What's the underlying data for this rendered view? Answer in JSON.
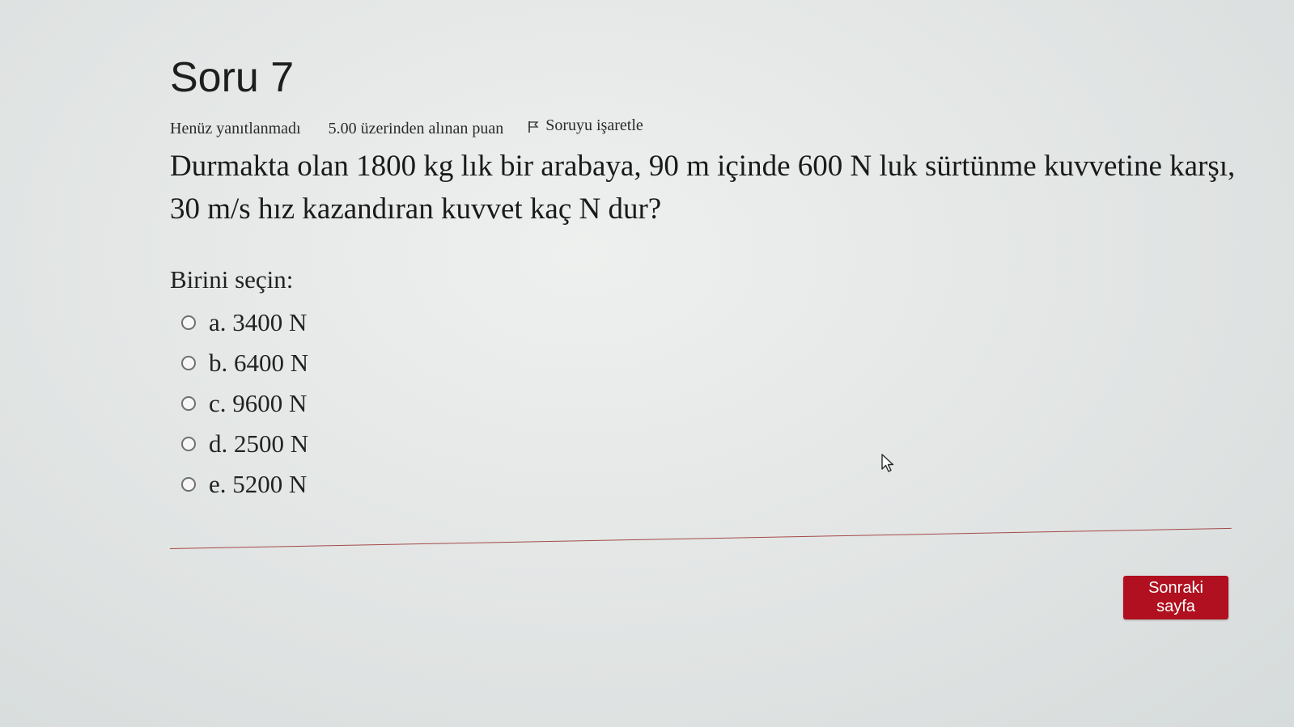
{
  "question": {
    "title": "Soru 7",
    "status": "Henüz yanıtlanmadı",
    "grade": "5.00 üzerinden alınan puan",
    "flag_label": "Soruyu işaretle",
    "text": "Durmakta olan 1800 kg lık bir arabaya, 90 m içinde 600 N luk sürtünme kuvvetine karşı, 30 m/s hız kazandıran kuvvet kaç N dur?",
    "prompt": "Birini seçin:",
    "answers": [
      {
        "label": "a. 3400 N"
      },
      {
        "label": "b. 6400 N"
      },
      {
        "label": "c. 9600 N"
      },
      {
        "label": "d. 2500 N"
      },
      {
        "label": "e. 5200 N"
      }
    ]
  },
  "navigation": {
    "next_label": "Sonraki sayfa"
  },
  "colors": {
    "accent": "#b0101f",
    "divider": "#a44a4a"
  },
  "icons": {
    "flag": "flag-icon",
    "pointer": "mouse-cursor-icon",
    "radio": "radio-button"
  }
}
